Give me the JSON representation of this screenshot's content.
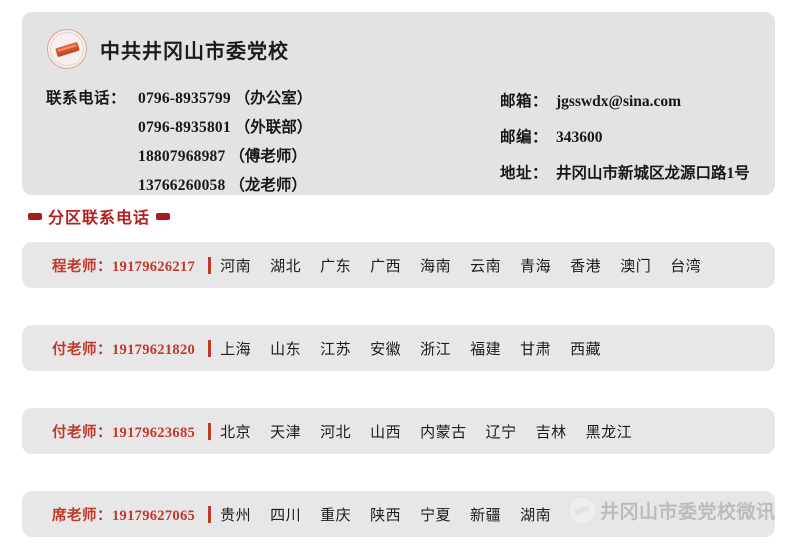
{
  "organization": {
    "name": "中共井冈山市委党校",
    "seal_icon": "circular-seal-icon"
  },
  "contact": {
    "phone_label": "联系电话：",
    "phones": [
      {
        "number": "0796-8935799",
        "note": "（办公室）"
      },
      {
        "number": "0796-8935801",
        "note": "（外联部）"
      },
      {
        "number": "18807968987",
        "note": "（傅老师）"
      },
      {
        "number": "13766260058",
        "note": "（龙老师）"
      }
    ],
    "email_label": "邮箱：",
    "email": "jgsswdx@sina.com",
    "postcode_label": "邮编：",
    "postcode": "343600",
    "address_label": "地址：",
    "address": "井冈山市新城区龙源口路1号"
  },
  "section": {
    "title": "分区联系电话",
    "marker_icon": "red-rect-marker-icon",
    "accent_color": "#b22222"
  },
  "regions": [
    {
      "teacher": "程老师：",
      "phone": "19179626217",
      "provinces": [
        "河南",
        "湖北",
        "广东",
        "广西",
        "海南",
        "云南",
        "青海",
        "香港",
        "澳门",
        "台湾"
      ]
    },
    {
      "teacher": "付老师：",
      "phone": "19179621820",
      "provinces": [
        "上海",
        "山东",
        "江苏",
        "安徽",
        "浙江",
        "福建",
        "甘肃",
        "西藏"
      ]
    },
    {
      "teacher": "付老师：",
      "phone": "19179623685",
      "provinces": [
        "北京",
        "天津",
        "河北",
        "山西",
        "内蒙古",
        "辽宁",
        "吉林",
        "黑龙江"
      ]
    },
    {
      "teacher": "席老师：",
      "phone": "19179627065",
      "provinces": [
        "贵州",
        "四川",
        "重庆",
        "陕西",
        "宁夏",
        "新疆",
        "湖南"
      ]
    }
  ],
  "watermark": {
    "text": "井冈山市委党校微讯",
    "logo_icon": "watermark-seal-icon"
  },
  "colors": {
    "accent_red": "#c0392b",
    "card_bg": "#e5e5e5",
    "page_bg": "#ffffff"
  }
}
